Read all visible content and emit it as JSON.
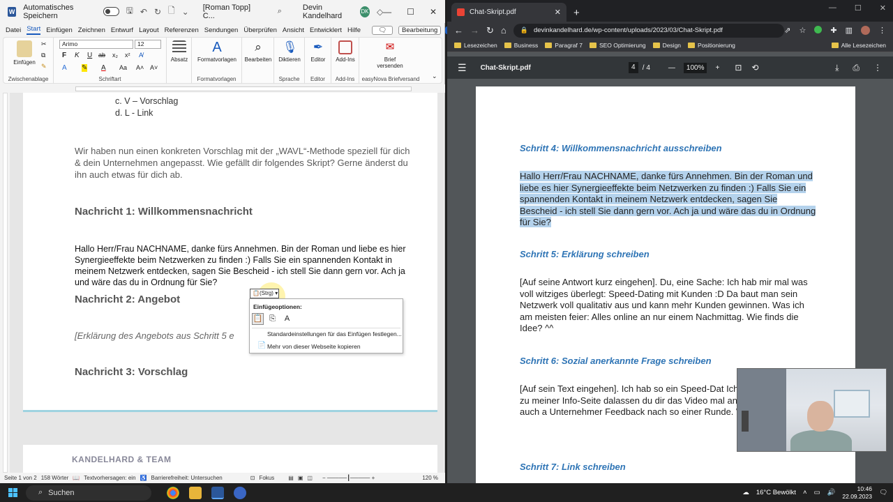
{
  "word": {
    "title": {
      "logo": "W",
      "autosave_label": "Automatisches Speichern",
      "document": "[Roman Topp] C...",
      "user_name": "Devin Kandelhard",
      "user_initials": "DK"
    },
    "tabs": [
      "Datei",
      "Start",
      "Einfügen",
      "Zeichnen",
      "Entwurf",
      "Layout",
      "Referenzen",
      "Sendungen",
      "Überprüfen",
      "Ansicht",
      "Entwicklert",
      "Hilfe"
    ],
    "edit_mode": "Bearbeitung",
    "ribbon": {
      "paste": "Einfügen",
      "font_name": "Arimo",
      "font_size": "12",
      "paragraph": "Absatz",
      "styles": "Formatvorlagen",
      "editing": "Bearbeiten",
      "dictate": "Diktieren",
      "editor": "Editor",
      "addins": "Add-Ins",
      "brief": "Brief versenden",
      "groups": {
        "clipboard": "Zwischenablage",
        "font": "Schriftart",
        "styles": "Formatvorlagen",
        "voice": "Sprache",
        "editor": "Editor",
        "addins": "Add-Ins",
        "easynova": "easyNova Briefversand"
      }
    },
    "doc": {
      "list_c": "c.   V – Vorschlag",
      "list_d": "d.   L - Link",
      "intro": "Wir haben nun einen konkreten Vorschlag mit der „WAVL“-Methode speziell für dich & dein Unternehmen angepasst. Wie gefällt dir folgendes Skript? Gerne änderst du ihn auch etwas für dich ab.",
      "h1": "Nachricht 1: Willkommensnachricht",
      "body1": "Hallo Herr/Frau NACHNAME, danke fürs Annehmen. Bin der Roman und liebe es hier Synergieeffekte beim Netzwerken zu finden :) Falls Sie ein spannenden Kontakt in meinem Netzwerk entdecken, sagen Sie Bescheid - ich stell Sie dann gern vor. Ach ja und wäre das du in Ordnung für Sie?",
      "h2": "Nachricht 2: Angebot",
      "ital": "[Erklärung des Angebots aus Schritt 5 e",
      "h3": "Nachricht 3: Vorschlag",
      "footer_logo": "KANDELHARD & TEAM"
    },
    "paste_menu": {
      "tag": "(Strg)",
      "header": "Einfügeoptionen:",
      "item1": "Standardeinstellungen für das Einfügen festlegen...",
      "item2": "Mehr von dieser Webseite kopieren"
    },
    "status": {
      "page": "Seite 1 von 2",
      "words": "158 Wörter",
      "predict": "Textvorhersagen: ein",
      "access": "Barrierefreiheit: Untersuchen",
      "focus": "Fokus",
      "zoom": "120 %"
    }
  },
  "browser": {
    "tab_title": "Chat-Skript.pdf",
    "url": "devinkandelhard.de/wp-content/uploads/2023/03/Chat-Skript.pdf",
    "bookmarks": [
      "Lesezeichen",
      "Business",
      "Paragraf 7",
      "SEO Optimierung",
      "Design",
      "Positionierung"
    ],
    "all_bookmarks": "Alle Lesezeichen",
    "pdf": {
      "title": "Chat-Skript.pdf",
      "page_current": "4",
      "page_total": "/ 4",
      "zoom": "100%",
      "s4": "Schritt 4: Willkommensnachricht ausschreiben",
      "p4": "Hallo Herr/Frau NACHNAME, danke fürs Annehmen. Bin der Roman und liebe es hier Synergieeffekte beim Netzwerken zu finden :)  Falls Sie ein spannenden Kontakt in meinem Netzwerk entdecken, sagen Sie Bescheid - ich stell Sie dann gern vor. Ach ja und wäre das du in Ordnung für Sie?",
      "s5": "Schritt 5: Erklärung schreiben",
      "p5": "[Auf seine Antwort kurz eingehen]. Du, eine Sache: Ich hab mir mal was voll witziges überlegt: Speed-Dating mit Kunden :D Da baut man sein Netzwerk voll qualitativ aus und kann mehr Kunden gewinnen. Was ich am meisten feier: Alles online an nur einem Nachmittag. Wie finds die Idee? ^^",
      "s6": "Schritt 6: Sozial anerkannte Frage schreiben",
      "p6": "[Auf sein Text eingehen]. Ich hab so ein Speed-Dat Ich kann einen Link zu meiner Info-Seite dalassen du dir das Video mal anschauen. Da geben auch a Unternehmer Feedback nach so einer Runde. Wä dich?",
      "s7": "Schritt 7: Link schreiben"
    }
  },
  "taskbar": {
    "search": "Suchen",
    "weather": "16°C Bewölkt",
    "time": "10:46",
    "date": "22.09.2023"
  }
}
